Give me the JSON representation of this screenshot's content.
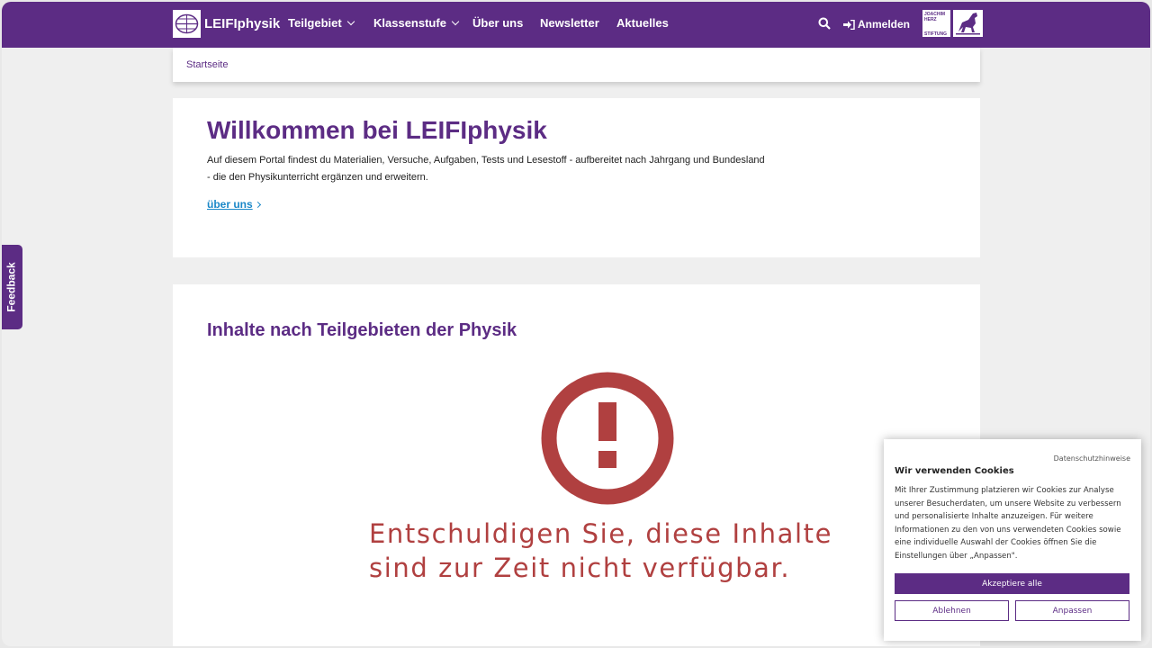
{
  "header": {
    "logo_text": "LEIFIphysik",
    "nav": [
      "Teilgebiet",
      "Klassenstufe",
      "Über uns",
      "Newsletter",
      "Aktuelles"
    ],
    "login_label": "Anmelden",
    "foundation_lines": [
      "JOACHIM",
      "HERZ",
      "STIFTUNG"
    ]
  },
  "breadcrumb": "Startseite",
  "welcome": {
    "title": "Willkommen bei LEIFIphysik",
    "text": "Auf diesem Portal findest du Materialien, Versuche, Aufgaben, Tests und Lesestoff - aufbereitet nach Jahrgang und Bundesland - die den Physikunterricht ergänzen und erweitern.",
    "link": "über uns"
  },
  "topics": {
    "title": "Inhalte nach Teilgebieten der Physik",
    "error_line1": "Entschuldigen Sie, diese Inhalte",
    "error_line2": "sind zur Zeit nicht verfügbar."
  },
  "feedback_label": "Feedback",
  "cookie": {
    "privacy_link": "Datenschutzhinweise",
    "title": "Wir verwenden Cookies",
    "text": "Mit Ihrer Zustimmung platzieren wir Cookies zur Analyse unserer Besucherdaten, um unsere Website zu verbessern und personalisierte Inhalte anzuzeigen. Für weitere Informationen zu den von uns verwendeten Cookies sowie eine individuelle Auswahl der Cookies öffnen Sie die Einstellungen über „Anpassen\".",
    "accept": "Akzeptiere alle",
    "reject": "Ablehnen",
    "customize": "Anpassen"
  },
  "colors": {
    "brand": "#5c2c84",
    "link": "#1b88c8",
    "error": "#b04040"
  }
}
